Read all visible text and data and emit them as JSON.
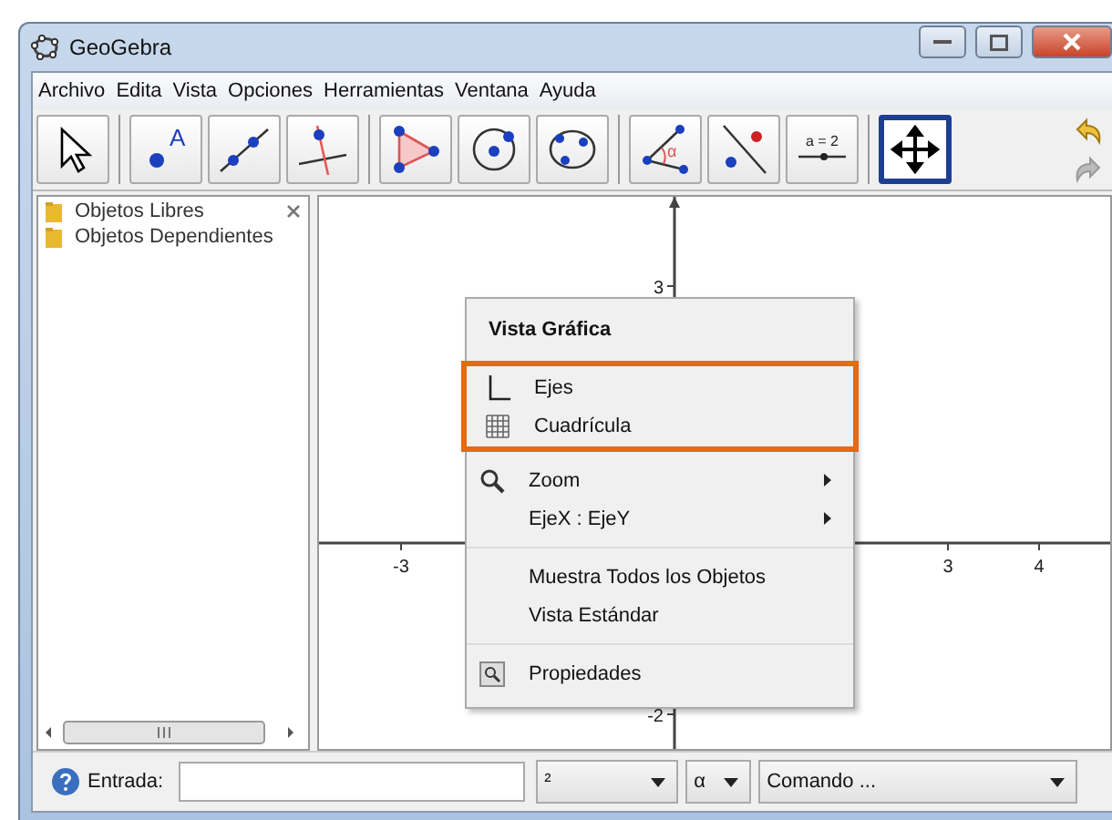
{
  "window": {
    "title": "GeoGebra"
  },
  "menu_bar": [
    "Archivo",
    "Edita",
    "Vista",
    "Opciones",
    "Herramientas",
    "Ventana",
    "Ayuda"
  ],
  "toolbar": {
    "tool_groups": [
      {
        "tools": [
          {
            "kind": "pointer",
            "selected": false
          }
        ]
      },
      {
        "tools": [
          {
            "kind": "point",
            "label": "A",
            "selected": false
          },
          {
            "kind": "line",
            "selected": false
          },
          {
            "kind": "perpendicular",
            "selected": false
          }
        ]
      },
      {
        "tools": [
          {
            "kind": "polygon",
            "selected": false
          },
          {
            "kind": "circle",
            "selected": false
          },
          {
            "kind": "conic",
            "selected": false
          }
        ]
      },
      {
        "tools": [
          {
            "kind": "angle",
            "label": "α",
            "selected": false
          },
          {
            "kind": "reflect",
            "selected": false
          },
          {
            "kind": "slider",
            "label": "a = 2",
            "selected": false
          }
        ]
      },
      {
        "tools": [
          {
            "kind": "move-view",
            "selected": true
          }
        ]
      }
    ]
  },
  "algebra_view": {
    "items": [
      {
        "label": "Objetos Libres"
      },
      {
        "label": "Objetos Dependientes"
      }
    ]
  },
  "graphics_view": {
    "x_ticks": [
      {
        "label": "-3"
      },
      {
        "label": "3"
      },
      {
        "label": "4"
      }
    ],
    "y_ticks": [
      {
        "label": "3"
      },
      {
        "label": "-2"
      }
    ]
  },
  "context_menu": {
    "title": "Vista Gráfica",
    "sections": [
      {
        "highlighted": true,
        "items": [
          {
            "label": "Ejes",
            "kind": "axes",
            "submenu": false
          },
          {
            "label": "Cuadrícula",
            "kind": "grid",
            "submenu": false
          }
        ]
      },
      {
        "highlighted": false,
        "items": [
          {
            "label": "Zoom",
            "kind": "zoom",
            "submenu": true
          },
          {
            "label": "EjeX : EjeY",
            "kind": "plain",
            "submenu": true
          }
        ]
      },
      {
        "highlighted": false,
        "items": [
          {
            "label": "Muestra Todos los Objetos",
            "kind": "plain",
            "submenu": false
          },
          {
            "label": "Vista Estándar",
            "kind": "plain",
            "submenu": false
          }
        ]
      },
      {
        "highlighted": false,
        "items": [
          {
            "label": "Propiedades",
            "kind": "properties",
            "submenu": false
          }
        ]
      }
    ]
  },
  "input_bar": {
    "label": "Entrada:",
    "symbol_dropdown": "²",
    "greek_dropdown": "α",
    "command_dropdown": "Comando ..."
  }
}
